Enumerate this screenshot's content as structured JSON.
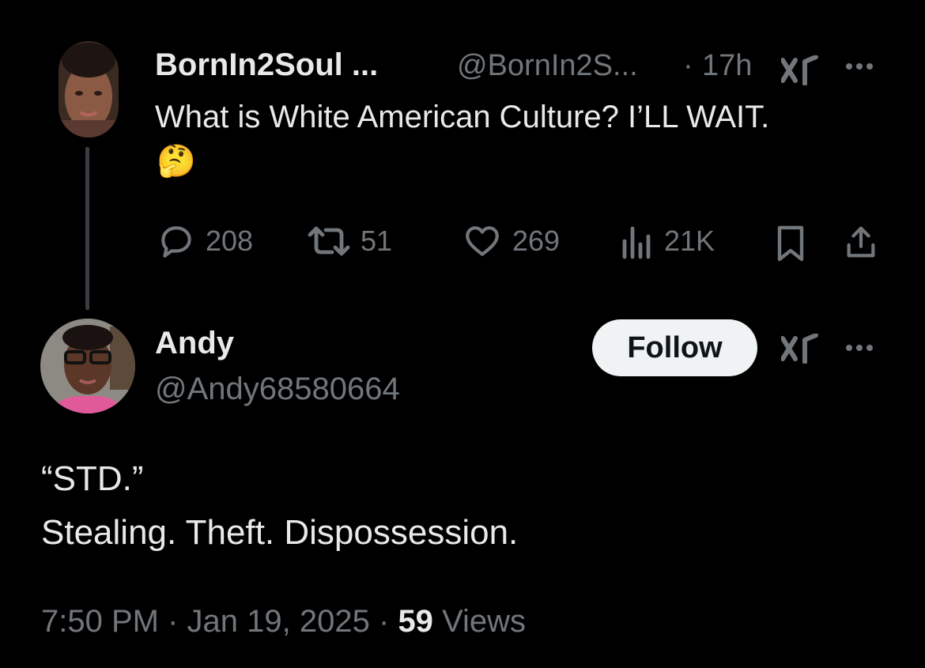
{
  "parent_tweet": {
    "display_name": "BornIn2Soul ...",
    "handle": "@BornIn2S...",
    "separator": "·",
    "time": "17h",
    "text_line1": "What is White American Culture? I’LL WAIT.",
    "emoji": "🤔",
    "actions": {
      "replies": "208",
      "retweets": "51",
      "likes": "269",
      "views": "21K"
    }
  },
  "reply_tweet": {
    "display_name": "Andy",
    "handle": "@Andy68580664",
    "follow_label": "Follow",
    "text_line1": "“STD.”",
    "text_line2": "Stealing. Theft. Dispossession.",
    "meta": {
      "time": "7:50 PM",
      "sep1": "·",
      "date": "Jan 19, 2025",
      "sep2": "·",
      "views_count": "59",
      "views_label": "Views"
    }
  },
  "icons": [
    "grok-icon",
    "more-icon",
    "reply-icon",
    "retweet-icon",
    "like-icon",
    "views-icon",
    "bookmark-icon",
    "share-icon"
  ],
  "colors": {
    "background": "#000000",
    "text_primary": "#e7e9ea",
    "text_muted": "#71767b",
    "follow_bg": "#eff3f4",
    "thread_line": "#3a3d41"
  }
}
